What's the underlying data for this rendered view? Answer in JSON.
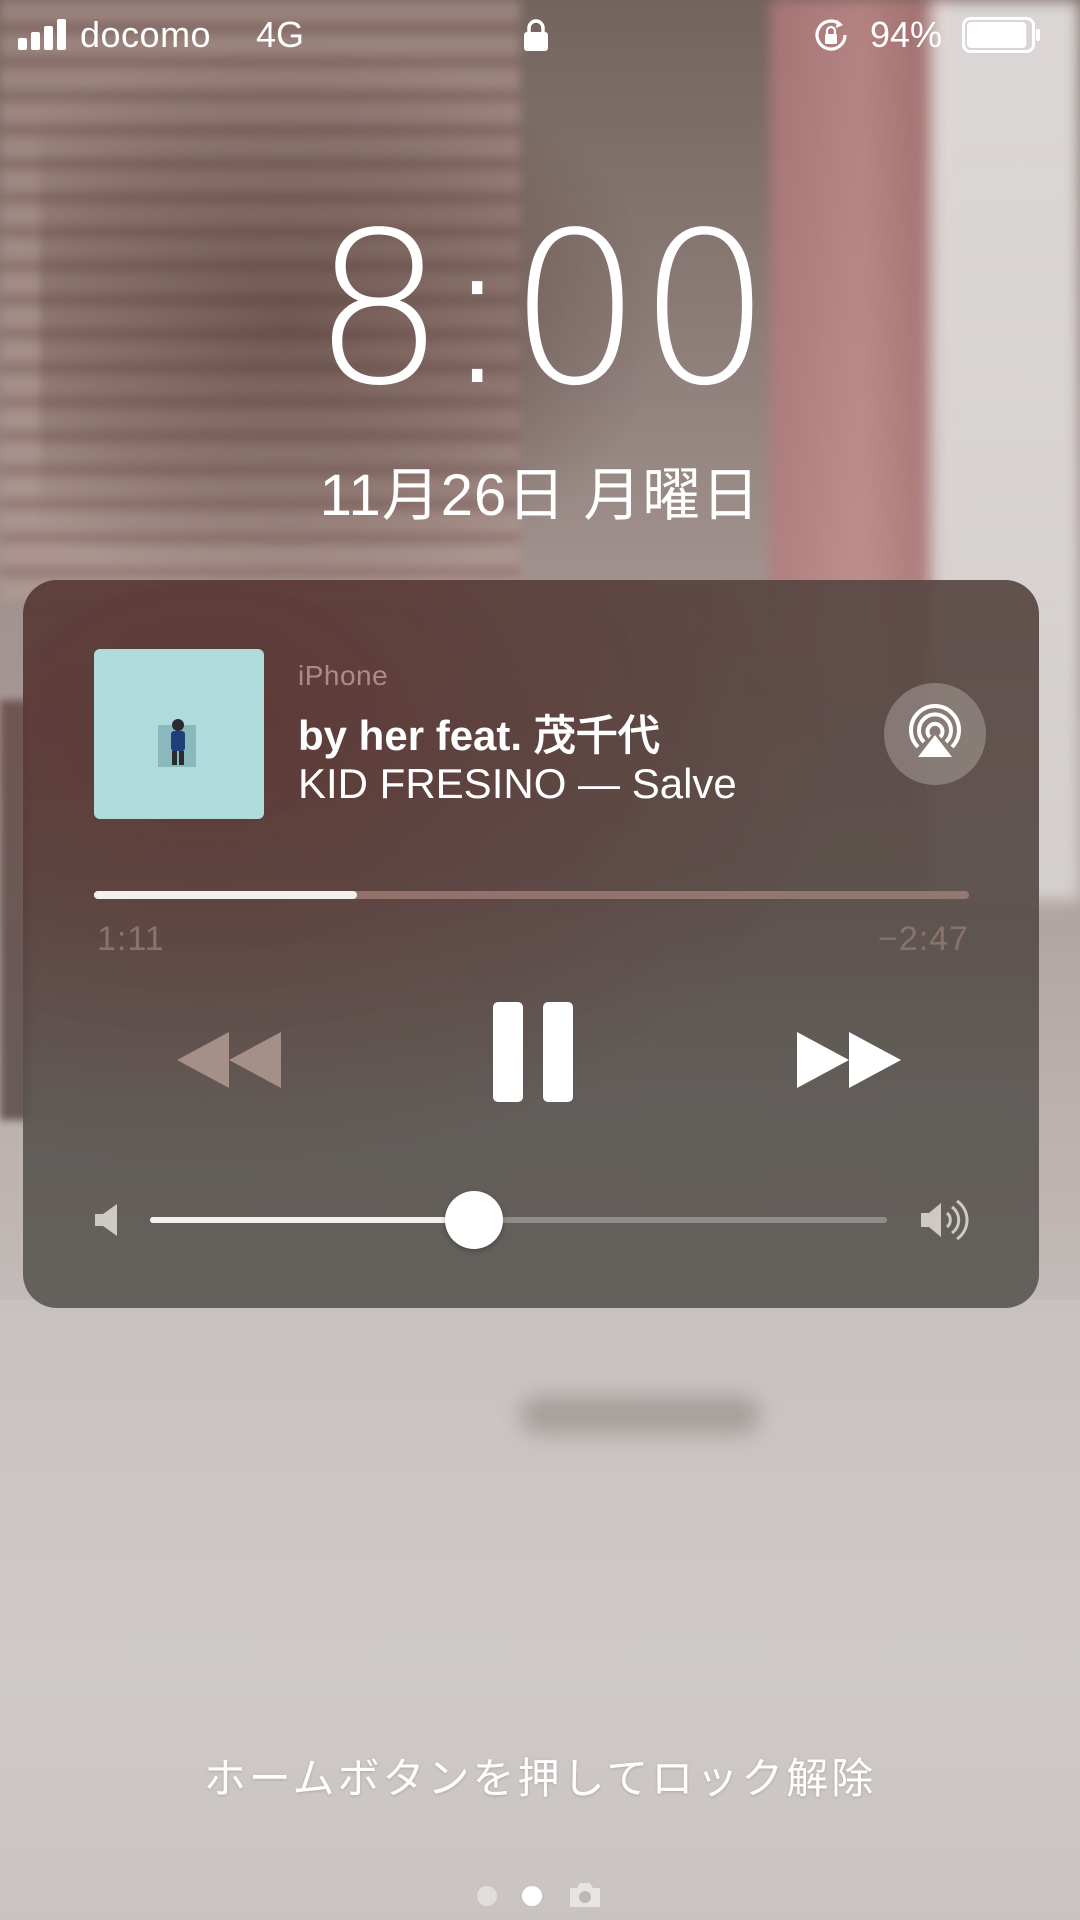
{
  "status_bar": {
    "carrier": "docomo",
    "network": "4G",
    "battery_percent": "94%",
    "battery_level": 0.94,
    "icons": [
      "signal-icon",
      "lock-icon",
      "rotation-lock-icon",
      "battery-icon"
    ]
  },
  "lock_screen": {
    "time": "8:00",
    "date": "11月26日 月曜日",
    "unlock_hint": "ホームボタンを押してロック解除"
  },
  "now_playing": {
    "source": "iPhone",
    "title": "by her feat. 茂千代",
    "subtitle": "KID FRESINO — Salve",
    "elapsed": "1:11",
    "remaining": "−2:47",
    "progress": 0.3,
    "volume": 0.44,
    "artwork_color": "#aedcdc",
    "controls": {
      "rewind": "rewind-icon",
      "pause": "pause-icon",
      "forward": "fast-forward-icon",
      "airplay": "airplay-icon",
      "volume_min": "speaker-low-icon",
      "volume_max": "speaker-high-icon"
    }
  },
  "pager": {
    "page_count": 2,
    "current_page": 2,
    "trailing_icon": "camera-icon"
  }
}
